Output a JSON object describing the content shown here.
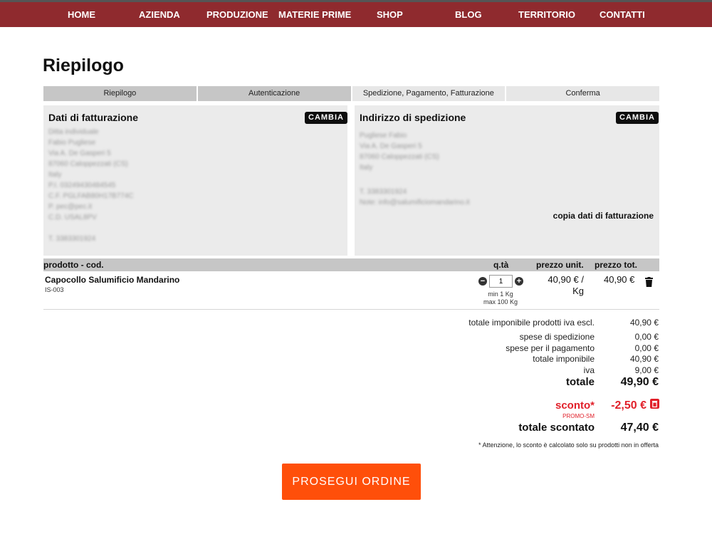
{
  "nav": {
    "items": [
      "HOME",
      "AZIENDA",
      "PRODUZIONE",
      "MATERIE PRIME",
      "SHOP",
      "BLOG",
      "TERRITORIO",
      "CONTATTI"
    ]
  },
  "page": {
    "title": "Riepilogo"
  },
  "steps": [
    {
      "label": "Riepilogo",
      "state": "done"
    },
    {
      "label": "Autenticazione",
      "state": "done"
    },
    {
      "label": "Spedizione, Pagamento, Fatturazione",
      "state": "active"
    },
    {
      "label": "Conferma",
      "state": "todo"
    }
  ],
  "billing": {
    "title": "Dati di fatturazione",
    "change_label": "CAMBIA",
    "lines": [
      "Ditta individuale",
      "Fabio Pugliese",
      "Via A. De Gasperi 5",
      "87060 Caloppezzati (CS)",
      "Italy",
      "P.I. 03249430484545",
      "C.F. PGLFAB80H17B774C",
      "P. pec@pec.it",
      "C.D. USAL8PV",
      "",
      "T. 3383301924"
    ]
  },
  "shipping": {
    "title": "Indirizzo di spedizione",
    "change_label": "CAMBIA",
    "lines": [
      "Pugliese Fabio",
      "Via A. De Gasperi 5",
      "87060 Caloppezzati (CS)",
      "Italy",
      "",
      "T. 3383301924",
      "Note: info@salumificiomandarino.it"
    ],
    "copy_label": "copia dati di fatturazione"
  },
  "table": {
    "headers": {
      "product": "prodotto - cod.",
      "qty": "q.tà",
      "unit_price": "prezzo unit.",
      "total_price": "prezzo tot."
    },
    "rows": [
      {
        "name": "Capocollo Salumificio Mandarino",
        "code": "IS-003",
        "qty": "1",
        "min": "min 1 Kg",
        "max": "max 100 Kg",
        "unit_price": "40,90 € / Kg",
        "total_price": "40,90 €"
      }
    ]
  },
  "totals": {
    "imponibile_prodotti_label": "totale imponibile prodotti iva escl.",
    "imponibile_prodotti": "40,90 €",
    "spedizione_label": "spese di spedizione",
    "spedizione": "0,00 €",
    "pagamento_label": "spese per il pagamento",
    "pagamento": "0,00 €",
    "imponibile_label": "totale imponibile",
    "imponibile": "40,90 €",
    "iva_label": "iva",
    "iva": "9,00 €",
    "totale_label": "totale",
    "totale": "49,90 €",
    "sconto_label": "sconto*",
    "sconto": "-2,50 €",
    "promo_code": "PROMO-SM",
    "scontato_label": "totale scontato",
    "scontato": "47,40 €",
    "note": "* Attenzione, lo sconto è calcolato solo su prodotti non in offerta"
  },
  "actions": {
    "proceed_label": "PROSEGUI ORDINE"
  },
  "colors": {
    "nav": "#8f2a2e",
    "accent": "#ff4f0a",
    "discount": "#e1202a"
  }
}
